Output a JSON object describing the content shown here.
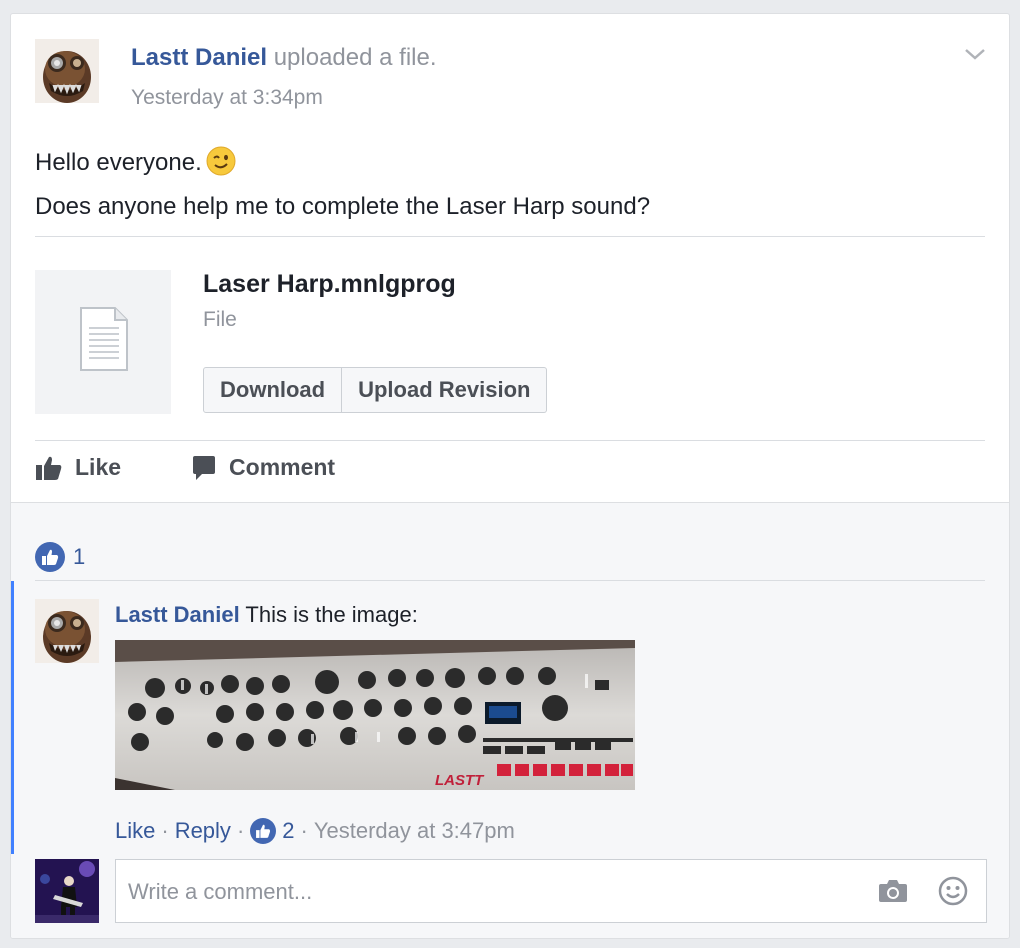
{
  "post": {
    "author": "Lastt Daniel",
    "action": "uploaded a file.",
    "timestamp": "Yesterday at 3:34pm",
    "text_line1": "Hello everyone.",
    "text_line2": "Does anyone help me to complete the Laser Harp sound?"
  },
  "file": {
    "name": "Laser Harp.mnlgprog",
    "type": "File",
    "download_label": "Download",
    "upload_revision_label": "Upload Revision"
  },
  "actions": {
    "like_label": "Like",
    "comment_label": "Comment"
  },
  "reactions": {
    "like_count": "1"
  },
  "comment": {
    "author": "Lastt Daniel",
    "text": "This is the image:",
    "image_label": "LASTT",
    "like_label": "Like",
    "separator": "·",
    "reply_label": "Reply",
    "like_count": "2",
    "timestamp": "Yesterday at 3:47pm"
  },
  "composer": {
    "placeholder": "Write a comment..."
  },
  "colors": {
    "link": "#365899",
    "muted": "#90949c",
    "accent": "#4080ff",
    "like_blue": "#4267b2"
  },
  "icons": [
    "chevron-down-icon",
    "wink-emoji-icon",
    "file-icon",
    "thumbs-up-icon",
    "comment-bubble-icon",
    "like-reaction-icon",
    "camera-icon",
    "smile-icon"
  ]
}
